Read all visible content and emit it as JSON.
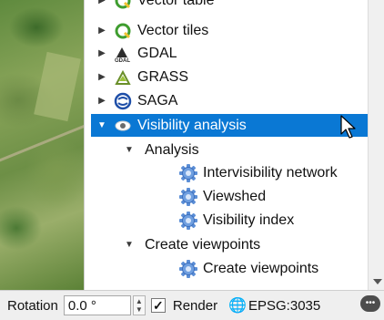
{
  "tree": {
    "items": [
      {
        "label": "Vector table",
        "icon": "q-icon",
        "arrow": "right"
      },
      {
        "label": "Vector tiles",
        "icon": "q-icon",
        "arrow": "right"
      },
      {
        "label": "GDAL",
        "icon": "gdal-icon",
        "arrow": "right"
      },
      {
        "label": "GRASS",
        "icon": "grass-icon",
        "arrow": "right"
      },
      {
        "label": "SAGA",
        "icon": "saga-icon",
        "arrow": "right"
      },
      {
        "label": "Visibility analysis",
        "icon": "eye-icon",
        "arrow": "down",
        "selected": true
      },
      {
        "label": "Analysis",
        "arrow": "down"
      },
      {
        "label": "Intervisibility network",
        "icon": "gear-icon"
      },
      {
        "label": "Viewshed",
        "icon": "gear-icon"
      },
      {
        "label": "Visibility index",
        "icon": "gear-icon"
      },
      {
        "label": "Create viewpoints",
        "arrow": "down"
      },
      {
        "label": "Create viewpoints",
        "icon": "gear-icon"
      }
    ]
  },
  "status": {
    "rotation_label": "Rotation",
    "rotation_value": "0.0 °",
    "render_label": "Render",
    "render_checked": true,
    "crs": "EPSG:3035"
  },
  "colors": {
    "selection": "#0a78d4",
    "gear": "#5b8ed6",
    "q_green": "#3f9d2f"
  }
}
